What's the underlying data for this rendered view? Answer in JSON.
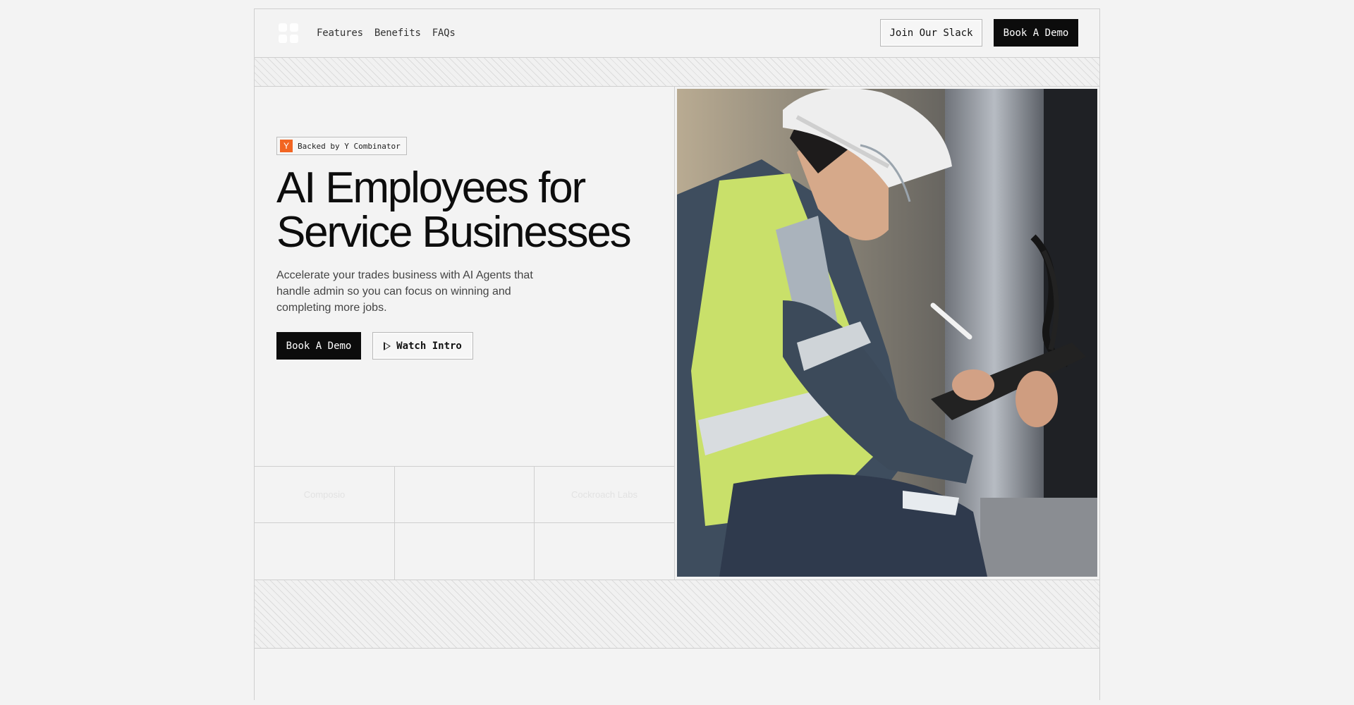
{
  "header": {
    "nav": [
      "Features",
      "Benefits",
      "FAQs"
    ],
    "join_slack": "Join Our Slack",
    "book_demo": "Book A Demo"
  },
  "hero": {
    "badge_logo": "Y",
    "badge_text": "Backed by Y Combinator",
    "title_line1": "AI Employees for",
    "title_line2": "Service Businesses",
    "subtitle": "Accelerate your trades business with AI Agents that handle admin so you can focus on winning and completing more jobs.",
    "cta_primary": "Book A Demo",
    "cta_secondary": "Watch Intro",
    "image_alt": "Worker in hard hat and safety vest writing on a tablet"
  },
  "logos": [
    "Composio",
    "",
    "Cockroach Labs",
    "",
    "",
    ""
  ],
  "icons": {
    "logo": "brand-logo-icon",
    "play": "play-icon"
  },
  "colors": {
    "accent": "#0c0c0c",
    "yc": "#f26522",
    "background": "#f3f3f3"
  }
}
